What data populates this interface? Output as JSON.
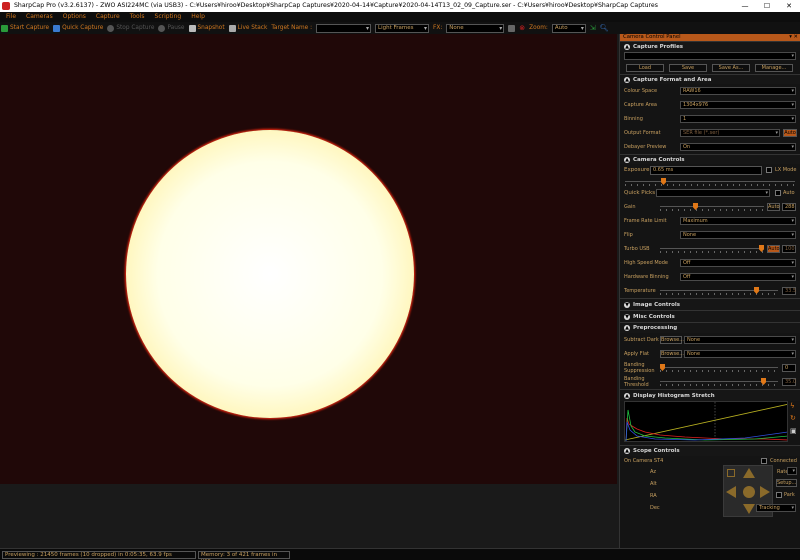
{
  "window": {
    "title": "SharpCap Pro (v3.2.6137) - ZWO ASI224MC (via USB3) - C:¥Users¥hiroo¥Desktop¥SharpCap Captures¥2020-04-14¥Capture¥2020-04-14T13_02_09_Capture.ser - C:¥Users¥hiroo¥Desktop¥SharpCap Captures",
    "minimize": "—",
    "maximize": "☐",
    "close": "✕"
  },
  "menu": [
    "File",
    "Cameras",
    "Options",
    "Capture",
    "Tools",
    "Scripting",
    "Help"
  ],
  "toolbar": {
    "start_capture": "Start Capture",
    "quick_capture": "Quick Capture",
    "stop_capture": "Stop Capture",
    "pause": "Pause",
    "snapshot": "Snapshot",
    "live_stack": "Live Stack",
    "target_name_label": "Target Name :",
    "target_name_value": "",
    "frame_type": "Light Frames",
    "fx_label": "FX:",
    "fx_value": "None",
    "zoom_label": "Zoom:",
    "zoom_value": "Auto"
  },
  "panel": {
    "title": "Camera Control Panel",
    "sections": {
      "capture_profiles": {
        "title": "Capture Profiles",
        "selected": "",
        "buttons": [
          "Load",
          "Save",
          "Save As...",
          "Manage..."
        ]
      },
      "capture_format": {
        "title": "Capture Format and Area",
        "colour_space_label": "Colour Space",
        "colour_space_value": "RAW16",
        "capture_area_label": "Capture Area",
        "capture_area_value": "1304x976",
        "binning_label": "Binning",
        "binning_value": "1",
        "output_format_label": "Output Format",
        "output_format_value": "SER file (*.ser)",
        "output_auto": "Auto",
        "debayer_label": "Debayer Preview",
        "debayer_value": "On"
      },
      "camera_controls": {
        "title": "Camera Controls",
        "exposure_label": "Exposure",
        "exposure_value": "0.65 ms",
        "lx_mode": "LX Mode",
        "quick_picks": "Quick Picks",
        "auto": "Auto",
        "gain_label": "Gain",
        "gain_auto": "Auto",
        "gain_value": "288",
        "frame_rate_label": "Frame Rate Limit",
        "frame_rate_value": "Maximum",
        "flip_label": "Flip",
        "flip_value": "None",
        "turbo_label": "Turbo USB",
        "turbo_auto": "Auto",
        "turbo_value": "100",
        "high_speed_label": "High Speed Mode",
        "high_speed_value": "Off",
        "hw_binning_label": "Hardware Binning",
        "hw_binning_value": "Off",
        "temperature_label": "Temperature",
        "temperature_value": "33.5"
      },
      "image_controls": {
        "title": "Image Controls"
      },
      "misc_controls": {
        "title": "Misc Controls"
      },
      "preprocessing": {
        "title": "Preprocessing",
        "subtract_dark_label": "Subtract Dark",
        "subtract_dark_browse": "Browse...",
        "subtract_dark_value": "None",
        "apply_flat_label": "Apply Flat",
        "apply_flat_browse": "Browse...",
        "apply_flat_value": "None",
        "banding_suppression_label": "Banding Suppression",
        "banding_suppression_value": "0",
        "banding_threshold_label": "Banding Threshold",
        "banding_threshold_value": "35.0"
      },
      "histogram": {
        "title": "Display Histogram Stretch"
      },
      "scope": {
        "title": "Scope Controls",
        "mount": "On Camera ST4",
        "connected": "Connected",
        "az_label": "Az",
        "alt_label": "Alt",
        "ra_label": "RA",
        "dec_label": "Dec",
        "rate_label": "Rate",
        "setup": "Setup...",
        "park": "Park",
        "tracking": "Tracking"
      }
    }
  },
  "status": {
    "previewing": "Previewing : 21450 frames (10 dropped) in 0:05:35, 63.9 fps",
    "memory": "Memory: 3 of 421 frames in use."
  },
  "colors": {
    "accent": "#d07820",
    "panel_title_bg": "#b8581a",
    "sun_edge": "#f04010"
  }
}
